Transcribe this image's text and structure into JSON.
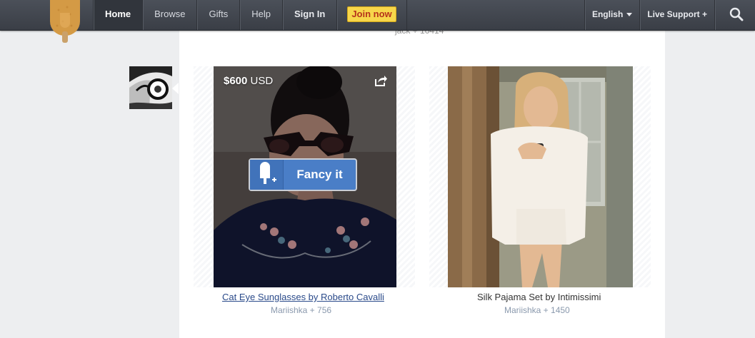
{
  "nav": {
    "items": [
      {
        "label": "Home"
      },
      {
        "label": "Browse"
      },
      {
        "label": "Gifts"
      },
      {
        "label": "Help"
      },
      {
        "label": "Sign In"
      }
    ],
    "join_label": "Join now",
    "language": "English",
    "support": "Live Support +"
  },
  "feed": {
    "previous_meta": "jack + 10414",
    "items": [
      {
        "price_amount": "$600",
        "price_currency": "USD",
        "fancy_label": "Fancy it",
        "title": "Cat Eye Sunglasses by Roberto Cavalli",
        "meta": "Mariishka + 756"
      },
      {
        "title": "Silk Pajama Set by Intimissimi",
        "meta": "Mariishka + 1450"
      }
    ]
  },
  "colors": {
    "join": "#f7d64b",
    "fancy_button": "#4a7ec7",
    "topbar": "#40444c"
  },
  "icons": [
    "popsicle-logo-icon",
    "search-icon",
    "share-icon",
    "fancy-popsicle-icon",
    "chevron-down-icon"
  ]
}
